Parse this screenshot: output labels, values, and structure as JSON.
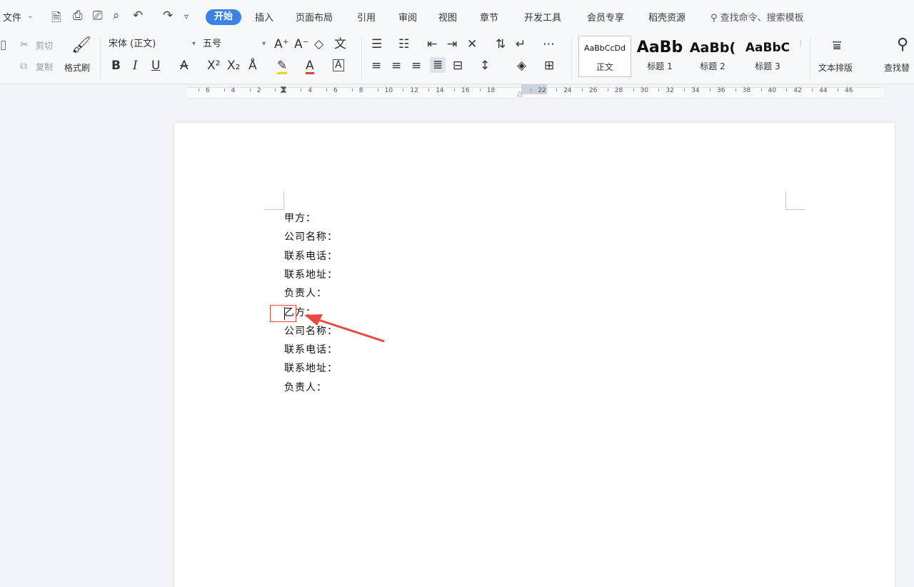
{
  "menu": {
    "file": "文件",
    "tabs": [
      "开始",
      "插入",
      "页面布局",
      "引用",
      "审阅",
      "视图",
      "章节",
      "开发工具",
      "会员专享",
      "稻壳资源"
    ],
    "active_tab": "开始",
    "search": "查找命令、搜索模板"
  },
  "ribbon": {
    "cut": "剪切",
    "copy": "复制",
    "format_painter": "格式刷",
    "font_name": "宋体 (正文)",
    "font_size": "五号",
    "styles": [
      {
        "sample": "AaBbCcDd",
        "name": "正文"
      },
      {
        "sample": "AaBb",
        "name": "标题 1"
      },
      {
        "sample": "AaBb(",
        "name": "标题 2"
      },
      {
        "sample": "AaBbC",
        "name": "标题 3"
      }
    ],
    "text_layout": "文本排版",
    "find_replace": "查找替"
  },
  "ruler": {
    "numbers": [
      "6",
      "4",
      "2",
      "2",
      "4",
      "6",
      "8",
      "10",
      "12",
      "14",
      "16",
      "18",
      "22",
      "24",
      "26",
      "28",
      "30",
      "32",
      "34",
      "36",
      "38",
      "40",
      "42",
      "44",
      "46"
    ]
  },
  "document": {
    "lines": [
      "甲方：",
      "公司名称：",
      "联系电话：",
      "联系地址：",
      "负责人：",
      "乙方：",
      "公司名称：",
      "联系电话：",
      "联系地址：",
      "负责人："
    ]
  },
  "colors": {
    "accent": "#3b82e6",
    "annotation_red": "#e84a3f"
  }
}
